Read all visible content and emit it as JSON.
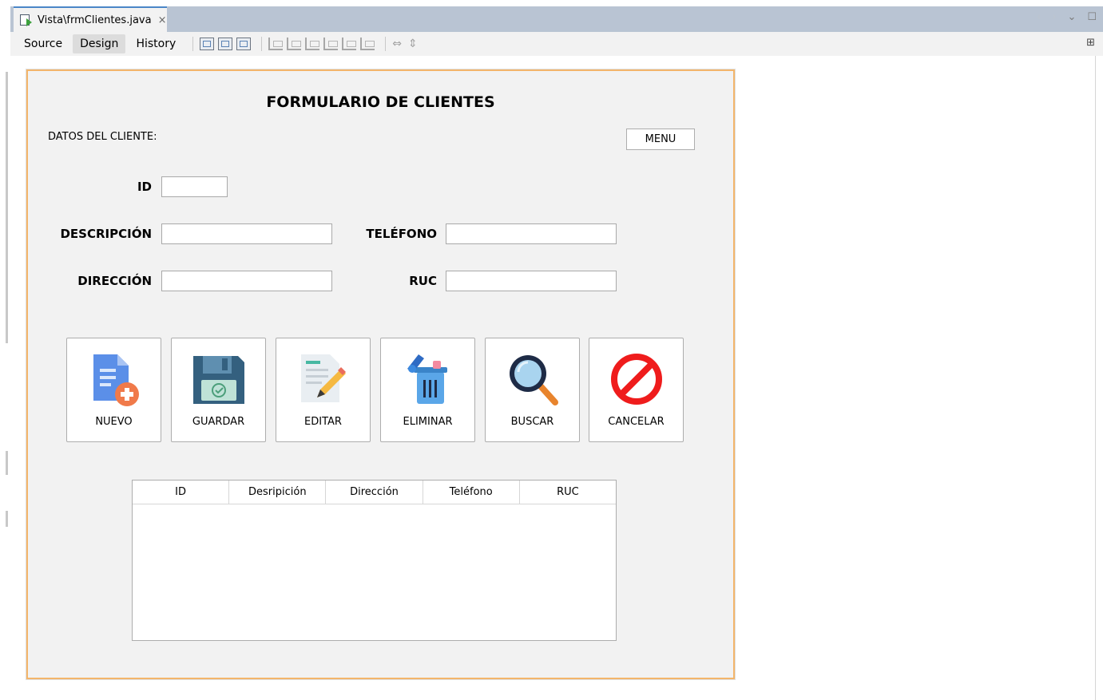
{
  "tab": {
    "title": "Vista\\frmClientes.java",
    "close": "×"
  },
  "tab_controls": {
    "prev": "‹",
    "next": "›",
    "dropdown": "⌄",
    "maximize": "☐"
  },
  "views": {
    "source": "Source",
    "design": "Design",
    "history": "History"
  },
  "toolbar_right": "⊞",
  "form": {
    "title": "FORMULARIO DE CLIENTES",
    "section": "DATOS DEL CLIENTE:",
    "menu_button": "MENU",
    "labels": {
      "id": "ID",
      "descripcion": "DESCRIPCIÓN",
      "telefono": "TELÉFONO",
      "direccion": "DIRECCIÓN",
      "ruc": "RUC"
    },
    "values": {
      "id": "",
      "descripcion": "",
      "telefono": "",
      "direccion": "",
      "ruc": ""
    }
  },
  "actions": [
    {
      "label": "NUEVO",
      "icon": "new-document-icon"
    },
    {
      "label": "GUARDAR",
      "icon": "floppy-disk-icon"
    },
    {
      "label": "EDITAR",
      "icon": "edit-document-icon"
    },
    {
      "label": "ELIMINAR",
      "icon": "trash-can-icon"
    },
    {
      "label": "BUSCAR",
      "icon": "magnifier-icon"
    },
    {
      "label": "CANCELAR",
      "icon": "cancel-icon"
    }
  ],
  "table": {
    "columns": [
      "ID",
      "Desripición",
      "Dirección",
      "Teléfono",
      "RUC"
    ],
    "rows": []
  },
  "colors": {
    "frame_border": "#f3b56b",
    "tab_accent": "#4a86c7",
    "form_bg": "#f2f2f2"
  }
}
